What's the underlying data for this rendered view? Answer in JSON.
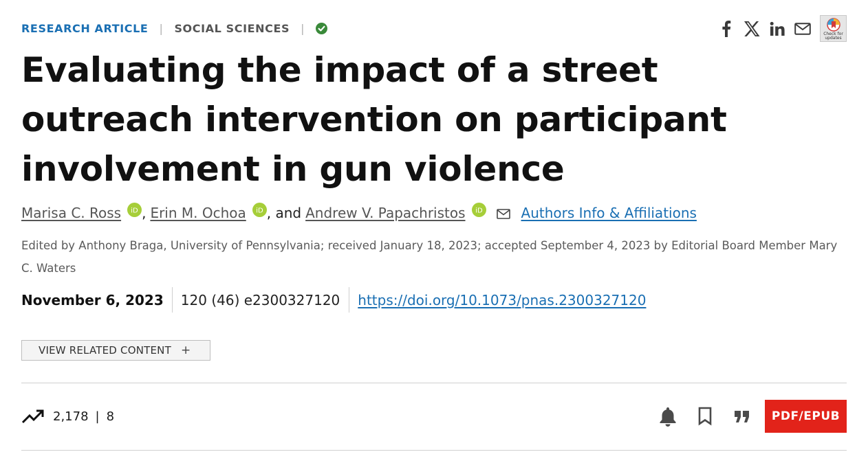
{
  "header": {
    "article_type": "RESEARCH ARTICLE",
    "separator": "|",
    "subject": "SOCIAL SCIENCES",
    "updates_badge_text": "Check for updates"
  },
  "share_icons": [
    "facebook-icon",
    "x-twitter-icon",
    "linkedin-icon",
    "email-icon"
  ],
  "title": "Evaluating the impact of a street outreach intervention on participant involvement in gun violence",
  "authors": {
    "list": [
      {
        "name": "Marisa C. Ross"
      },
      {
        "name": "Erin M. Ochoa"
      },
      {
        "name": "Andrew V. Papachristos"
      }
    ],
    "comma": ",",
    "and": ", and",
    "affiliations_link": "Authors Info & Affiliations"
  },
  "edited_note": "Edited by Anthony Braga, University of Pennsylvania; received January 18, 2023; accepted September 4, 2023 by Editorial Board Member Mary C. Waters",
  "meta": {
    "date": "November 6, 2023",
    "citation": "120 (46) e2300327120",
    "doi": "https://doi.org/10.1073/pnas.2300327120"
  },
  "related_button": {
    "label": "VIEW RELATED CONTENT",
    "plus": "+"
  },
  "metrics": {
    "views": "2,178",
    "separator": "|",
    "citations": "8"
  },
  "actions": {
    "pdf_label": "PDF/EPUB"
  },
  "colors": {
    "accent_blue": "#1a6fb3",
    "pdf_red": "#e2231a",
    "orcid_green": "#a6ce39",
    "check_green": "#3a8a3a"
  }
}
